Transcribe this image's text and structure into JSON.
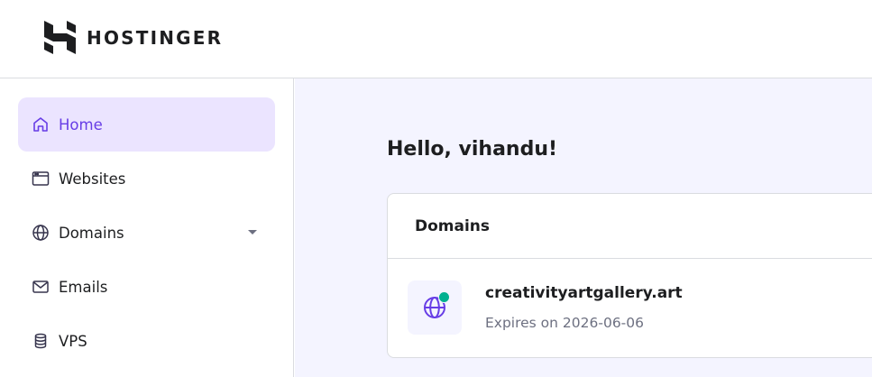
{
  "brand": {
    "name": "HOSTINGER",
    "logo_icon": "hostinger-logo-icon"
  },
  "sidebar": {
    "items": [
      {
        "label": "Home",
        "icon": "home-icon",
        "active": true
      },
      {
        "label": "Websites",
        "icon": "browser-window-icon"
      },
      {
        "label": "Domains",
        "icon": "globe-icon",
        "has_dropdown": true
      },
      {
        "label": "Emails",
        "icon": "envelope-icon"
      },
      {
        "label": "VPS",
        "icon": "database-icon"
      }
    ]
  },
  "main": {
    "greeting": "Hello, vihandu!",
    "domains_card": {
      "title": "Domains",
      "items": [
        {
          "name": "creativityartgallery.art",
          "expiry": "Expires on 2026-06-06",
          "icon": "globe-icon",
          "status_color": "#00b090"
        }
      ]
    }
  },
  "colors": {
    "accent": "#673de6",
    "active_bg": "#ebe4ff",
    "main_bg": "#f4f4ff",
    "status_ok": "#00b090"
  }
}
